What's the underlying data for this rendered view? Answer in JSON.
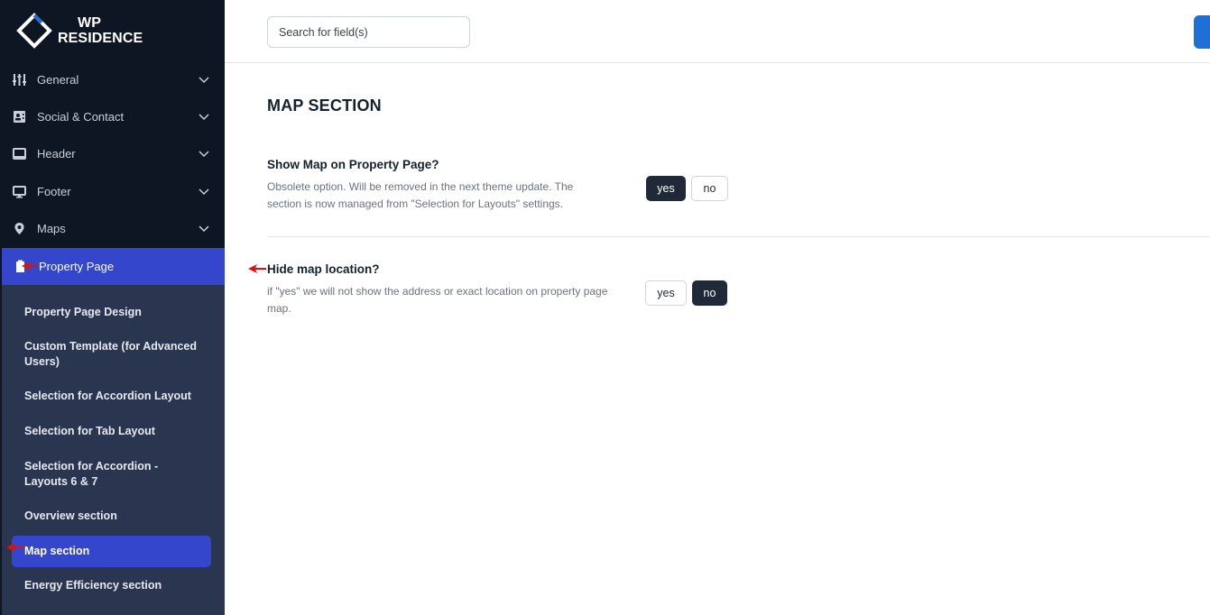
{
  "brand": {
    "line1": "WP",
    "line2": "RESIDENCE"
  },
  "sidebar": {
    "items": [
      {
        "label": "General",
        "icon": "sliders-icon"
      },
      {
        "label": "Social & Contact",
        "icon": "contact-card-icon"
      },
      {
        "label": "Header",
        "icon": "window-icon"
      },
      {
        "label": "Footer",
        "icon": "monitor-icon"
      },
      {
        "label": "Maps",
        "icon": "map-pin-icon"
      },
      {
        "label": "Property Page",
        "icon": "document-icon"
      }
    ],
    "sub_items": [
      "Property Page Design",
      "Custom Template (for Advanced Users)",
      "Selection for Accordion Layout",
      "Selection for Tab Layout",
      "Selection for Accordion - Layouts 6 & 7",
      "Overview section",
      "Map section",
      "Energy Efficiency section"
    ]
  },
  "search": {
    "placeholder": "Search for field(s)"
  },
  "main": {
    "section_title": "MAP SECTION",
    "options": [
      {
        "title": "Show Map on Property Page?",
        "description": "Obsolete option. Will be removed in the next theme update. The section is now managed from \"Selection for Layouts\" settings.",
        "yes_label": "yes",
        "no_label": "no",
        "selected": "yes"
      },
      {
        "title": "Hide map location?",
        "description": "if \"yes\" we will not show the address or exact location on property page map.",
        "yes_label": "yes",
        "no_label": "no",
        "selected": "no"
      }
    ]
  },
  "colors": {
    "sidebar_bg": "#0f1623",
    "submenu_bg": "#2a3550",
    "accent": "#3346cc",
    "toggle_active": "#1f2937",
    "annotation_arrow": "#e01010"
  }
}
